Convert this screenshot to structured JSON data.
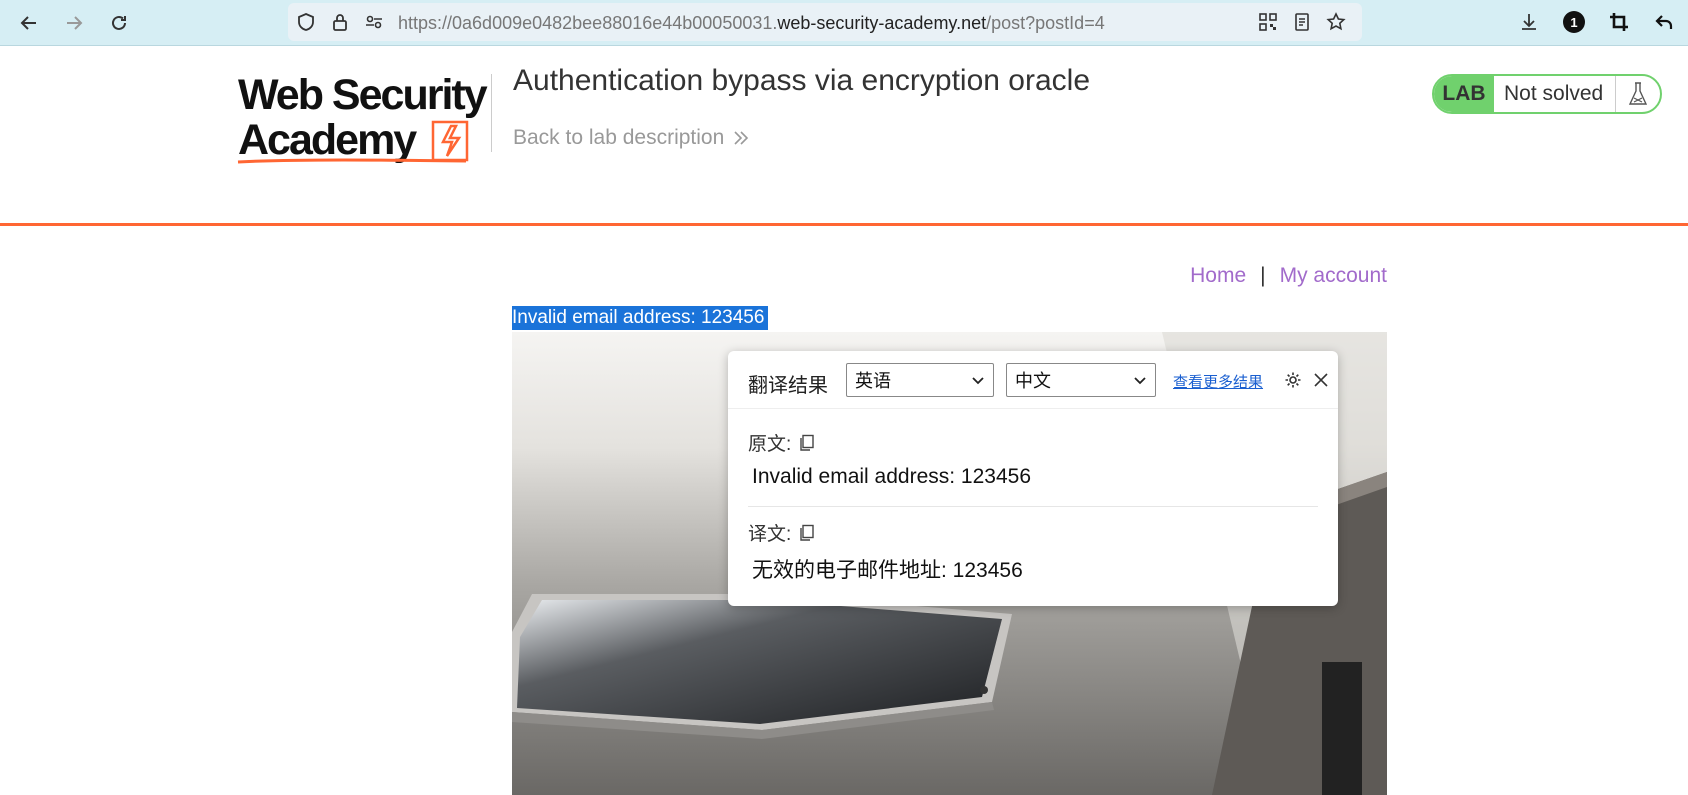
{
  "browser": {
    "url_prefix": "https://0a6d009e0482bee88016e44b00050031.",
    "url_host": "web-security-academy.net",
    "url_path": "/post?postId=4",
    "download_badge_count": "1"
  },
  "header": {
    "logo_line1": "Web Security",
    "logo_line2": "Academy",
    "lab_title": "Authentication bypass via encryption oracle",
    "back_link": "Back to lab description",
    "lab_badge": "LAB",
    "lab_status": "Not solved"
  },
  "nav": {
    "home": "Home",
    "separator": "|",
    "my_account": "My account"
  },
  "notification": "Invalid email address: 123456",
  "translator": {
    "title": "翻译结果",
    "source_lang": "英语",
    "target_lang": "中文",
    "more_link": "查看更多结果",
    "original_label": "原文:",
    "original_text": "Invalid email address: 123456",
    "translated_label": "译文:",
    "translated_text": "无效的电子邮件地址: 123456"
  },
  "colors": {
    "accent_orange": "#ff6633",
    "lab_green": "#70d16d",
    "link_purple": "#a26bcb",
    "selection_blue": "#1a73d9"
  }
}
